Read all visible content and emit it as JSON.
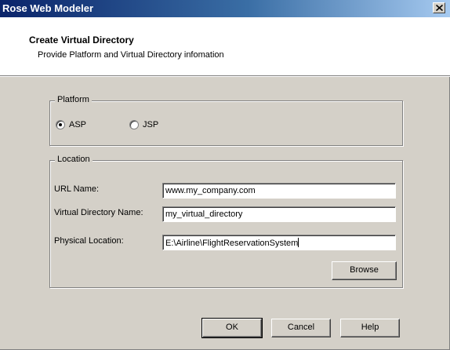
{
  "window": {
    "title": "Rose Web Modeler",
    "close_glyph": "×"
  },
  "header": {
    "title": "Create Virtual Directory",
    "subtitle": "Provide Platform and Virtual Directory infomation"
  },
  "platform": {
    "legend": "Platform",
    "options": [
      {
        "label": "ASP",
        "selected": true
      },
      {
        "label": "JSP",
        "selected": false
      }
    ]
  },
  "location": {
    "legend": "Location",
    "fields": [
      {
        "label": "URL Name:",
        "value": "www.my_company.com"
      },
      {
        "label": "Virtual Directory Name:",
        "value": "my_virtual_directory"
      },
      {
        "label": "Physical Location:",
        "value": "E:\\Airline\\FlightReservationSystem"
      }
    ],
    "browse_label": "Browse"
  },
  "buttons": {
    "ok": "OK",
    "cancel": "Cancel",
    "help": "Help"
  }
}
